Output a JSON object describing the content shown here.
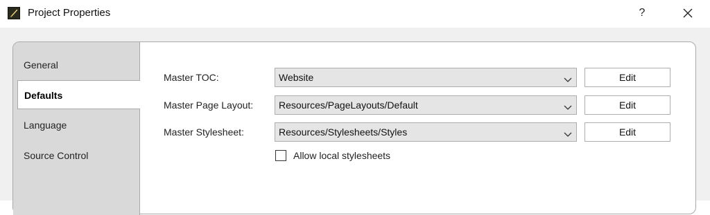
{
  "window": {
    "title": "Project Properties",
    "help_label": "?",
    "icon": "app-quill-icon",
    "close_icon": "close-icon"
  },
  "tabs": [
    {
      "label": "General",
      "active": false
    },
    {
      "label": "Defaults",
      "active": true
    },
    {
      "label": "Language",
      "active": false
    },
    {
      "label": "Source Control",
      "active": false
    }
  ],
  "form": {
    "rows": [
      {
        "label": "Master TOC:",
        "value": "Website",
        "button": "Edit"
      },
      {
        "label": "Master Page Layout:",
        "value": "Resources/PageLayouts/Default",
        "button": "Edit"
      },
      {
        "label": "Master Stylesheet:",
        "value": "Resources/Stylesheets/Styles",
        "button": "Edit"
      }
    ],
    "allow_local_stylesheets": {
      "label": "Allow local stylesheets",
      "checked": false
    }
  },
  "colors": {
    "tab_background": "#d9d9d9",
    "combo_background": "#e5e5e5",
    "border": "#a9a9a9"
  }
}
